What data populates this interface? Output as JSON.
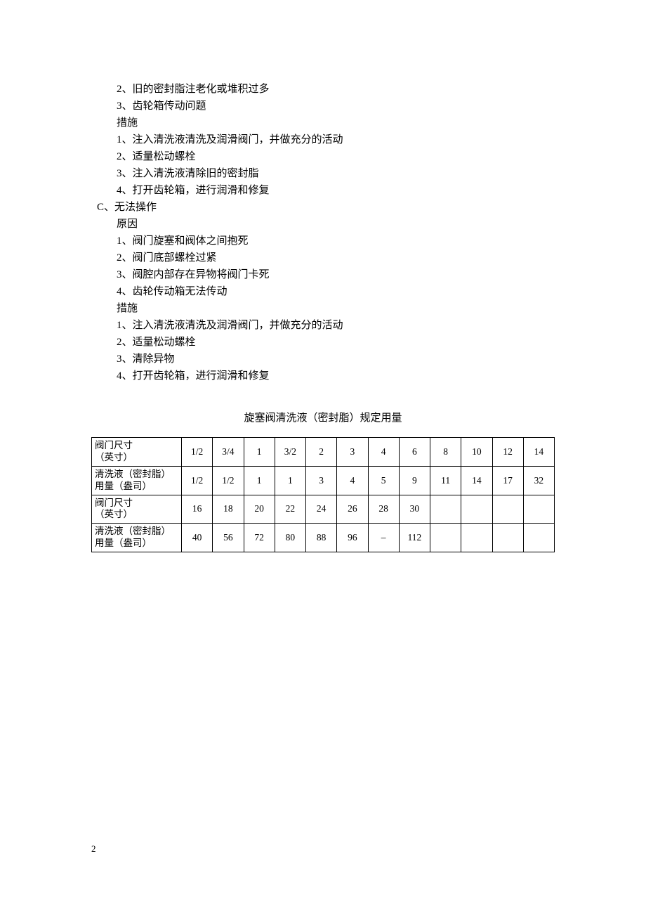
{
  "lines": [
    {
      "cls": "indent-1",
      "text": "2、旧的密封脂注老化或堆积过多"
    },
    {
      "cls": "indent-1",
      "text": "3、齿轮箱传动问题"
    },
    {
      "cls": "indent-1",
      "text": "措施"
    },
    {
      "cls": "indent-1",
      "text": "1、注入清洗液清洗及润滑阀门，并做充分的活动"
    },
    {
      "cls": "indent-1",
      "text": "2、适量松动螺栓"
    },
    {
      "cls": "indent-1",
      "text": "3、注入清洗液清除旧的密封脂"
    },
    {
      "cls": "indent-1",
      "text": "4、打开齿轮箱，进行润滑和修复"
    },
    {
      "cls": "indent-2",
      "text": "C、无法操作"
    },
    {
      "cls": "indent-1",
      "text": "原因"
    },
    {
      "cls": "indent-1",
      "text": "1、阀门旋塞和阀体之间抱死"
    },
    {
      "cls": "indent-1",
      "text": "2、阀门底部螺栓过紧"
    },
    {
      "cls": "indent-1",
      "text": "3、阀腔内部存在异物将阀门卡死"
    },
    {
      "cls": "indent-1",
      "text": "4、齿轮传动箱无法传动"
    },
    {
      "cls": "indent-1",
      "text": "措施"
    },
    {
      "cls": "indent-1",
      "text": "1、注入清洗液清洗及润滑阀门，并做充分的活动"
    },
    {
      "cls": "indent-1",
      "text": "2、适量松动螺栓"
    },
    {
      "cls": "indent-1",
      "text": "3、清除异物"
    },
    {
      "cls": "indent-1",
      "text": "4、打开齿轮箱，进行润滑和修复"
    }
  ],
  "table": {
    "title": "旋塞阀清洗液（密封脂）规定用量",
    "rows": [
      {
        "label": "阀门尺寸\n（英寸）",
        "cells": [
          "1/2",
          "3/4",
          "1",
          "3/2",
          "2",
          "3",
          "4",
          "6",
          "8",
          "10",
          "12",
          "14"
        ]
      },
      {
        "label": "清洗液（密封脂）\n用量（盎司）",
        "cells": [
          "1/2",
          "1/2",
          "1",
          "1",
          "3",
          "4",
          "5",
          "9",
          "11",
          "14",
          "17",
          "32"
        ]
      },
      {
        "label": "阀门尺寸\n（英寸）",
        "cells": [
          "16",
          "18",
          "20",
          "22",
          "24",
          "26",
          "28",
          "30",
          "",
          "",
          "",
          ""
        ]
      },
      {
        "label": "清洗液（密封脂）\n用量（盎司）",
        "cells": [
          "40",
          "56",
          "72",
          "80",
          "88",
          "96",
          "–",
          "112",
          "",
          "",
          "",
          ""
        ]
      }
    ]
  },
  "pageNumber": "2"
}
